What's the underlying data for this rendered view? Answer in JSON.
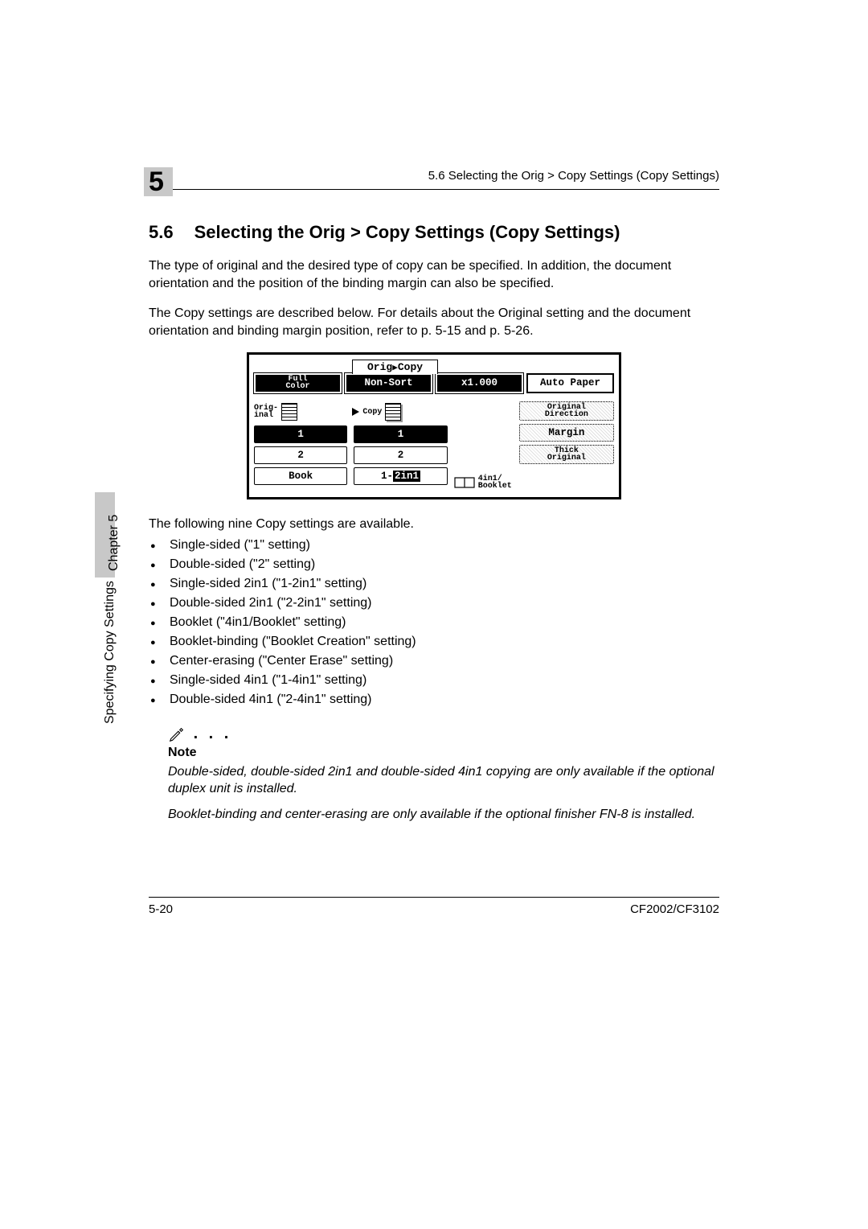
{
  "header": {
    "chapter_number": "5",
    "running_head": "5.6 Selecting the Orig > Copy Settings (Copy Settings)"
  },
  "section": {
    "number": "5.6",
    "title": "Selecting the Orig > Copy Settings (Copy Settings)",
    "para1": "The type of original and the desired type of copy can be specified. In addition, the document orientation and the position of the binding margin can also be specified.",
    "para2": "The Copy settings are described below. For details about the Original setting and the document orientation and binding margin position, refer to p. 5-15 and p. 5-26."
  },
  "lcd": {
    "tab": {
      "left": "Orig",
      "right": "Copy"
    },
    "row1": {
      "full_color_l1": "Full",
      "full_color_l2": "Color",
      "non_sort": "Non-Sort",
      "zoom": "x1.000",
      "auto_paper": "Auto Paper"
    },
    "col_a_head_l1": "Orig-",
    "col_a_head_l2": "inal",
    "col_b_head": "Copy",
    "col_c": {
      "orig_dir_l1": "Original",
      "orig_dir_l2": "Direction",
      "margin": "Margin",
      "thick_l1": "Thick",
      "thick_l2": "Original"
    },
    "buttons": {
      "a1": "1",
      "b1": "1",
      "a2": "2",
      "b2": "2",
      "a_book": "Book",
      "b_1_2in1_pre": "1-",
      "b_1_2in1_box": "2in1",
      "booklet_l1": "4in1/",
      "booklet_l2": "Booklet"
    }
  },
  "list_intro": "The following nine Copy settings are available.",
  "copy_settings": [
    "Single-sided (\"1\" setting)",
    "Double-sided (\"2\" setting)",
    "Single-sided 2in1 (\"1-2in1\" setting)",
    "Double-sided 2in1 (\"2-2in1\" setting)",
    "Booklet (\"4in1/Booklet\" setting)",
    "Booklet-binding (\"Booklet Creation\" setting)",
    "Center-erasing (\"Center Erase\" setting)",
    "Single-sided 4in1 (\"1-4in1\" setting)",
    "Double-sided 4in1 (\"2-4in1\" setting)"
  ],
  "note": {
    "heading": "Note",
    "body1": "Double-sided, double-sided 2in1 and double-sided 4in1 copying are only available if the optional duplex unit is installed.",
    "body2": "Booklet-binding and center-erasing are only available if the optional finisher FN-8 is installed."
  },
  "side": {
    "chapter": "Chapter 5",
    "label": "Specifying Copy Settings"
  },
  "footer": {
    "page": "5-20",
    "model": "CF2002/CF3102"
  }
}
